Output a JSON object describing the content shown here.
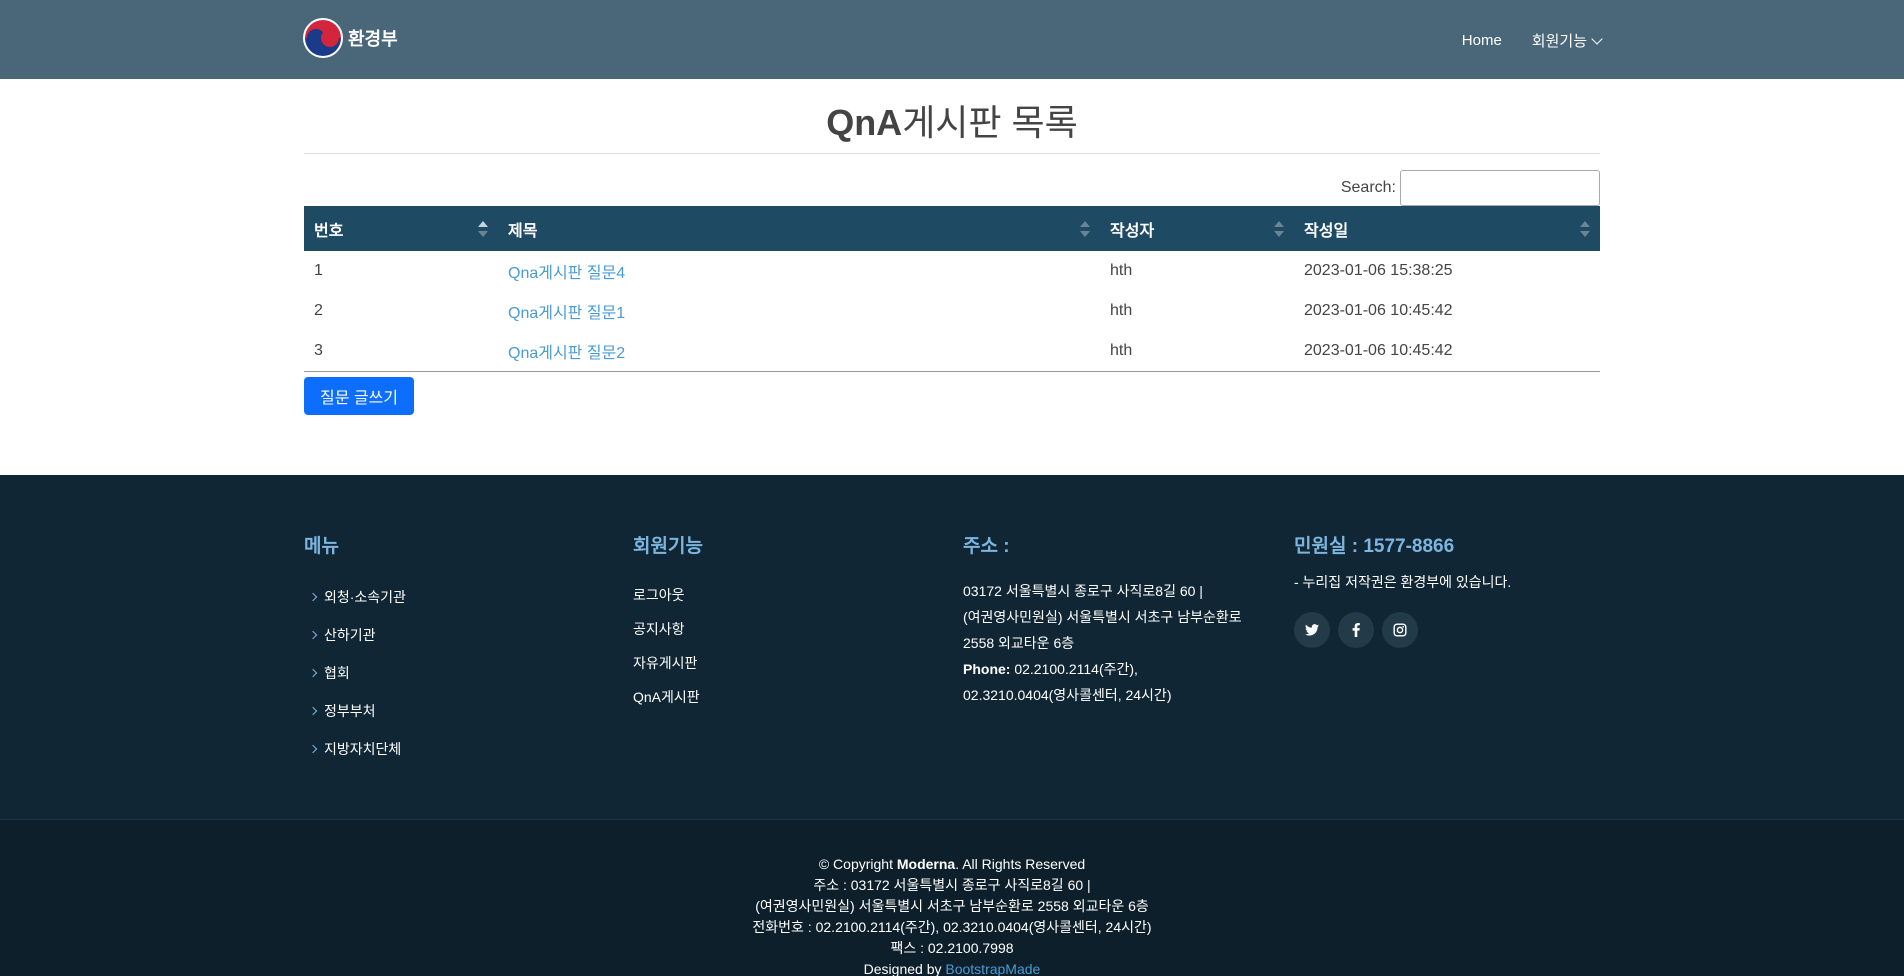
{
  "header": {
    "logo_text": "환경부",
    "nav": {
      "home": "Home",
      "member": "회원기능"
    }
  },
  "main": {
    "title_bold": "QnA",
    "title_rest": "게시판 목록",
    "search_label": "Search:",
    "search_value": "",
    "columns": [
      "번호",
      "제목",
      "작성자",
      "작성일"
    ],
    "rows": [
      {
        "no": "1",
        "title": "Qna게시판 질문4",
        "author": "hth",
        "date": "2023-01-06 15:38:25"
      },
      {
        "no": "2",
        "title": "Qna게시판 질문1",
        "author": "hth",
        "date": "2023-01-06 10:45:42"
      },
      {
        "no": "3",
        "title": "Qna게시판 질문2",
        "author": "hth",
        "date": "2023-01-06 10:45:42"
      }
    ],
    "write_button": "질문 글쓰기"
  },
  "footer": {
    "menu_title": "메뉴",
    "menu_items": [
      "외청·소속기관",
      "산하기관",
      "협회",
      "정부부처",
      "지방자치단체"
    ],
    "member_title": "회원기능",
    "member_items": [
      "로그아웃",
      "공지사항",
      "자유게시판",
      "QnA게시판"
    ],
    "address_title": "주소 :",
    "address_line1": "03172 서울특별시 종로구 사직로8길 60 |",
    "address_line2": "(여권영사민원실) 서울특별시 서초구 남부순환로",
    "address_line3": "2558 외교타운 6층",
    "phone_label": "Phone:",
    "phone_value": " 02.2100.2114(주간),",
    "phone_line2": "02.3210.0404(영사콜센터, 24시간)",
    "civil_title": "민원실 : 1577-8866",
    "copyright_note": "- 누리집 저작권은 환경부에 있습니다.",
    "socials": [
      "twitter-icon",
      "facebook-icon",
      "instagram-icon"
    ],
    "bottom": {
      "copy_prefix": "© Copyright ",
      "copy_brand": "Moderna",
      "copy_suffix": ". All Rights Reserved",
      "line2": "주소 : 03172 서울특별시 종로구 사직로8길 60 |",
      "line3": "(여권영사민원실) 서울특별시 서초구 남부순환로 2558 외교타운 6층",
      "line4": "전화번호 : 02.2100.2114(주간), 02.3210.0404(영사콜센터, 24시간)",
      "line5": "팩스 : 02.2100.7998",
      "designed_prefix": "Designed by ",
      "designed_link": "BootstrapMade"
    }
  },
  "colors": {
    "header_bg": "#4a6779",
    "table_header_bg": "#1f4a63",
    "link": "#4a9bd6",
    "button": "#0d6efd",
    "footer_bg": "#102634",
    "footer_accent": "#7cb6e0"
  }
}
